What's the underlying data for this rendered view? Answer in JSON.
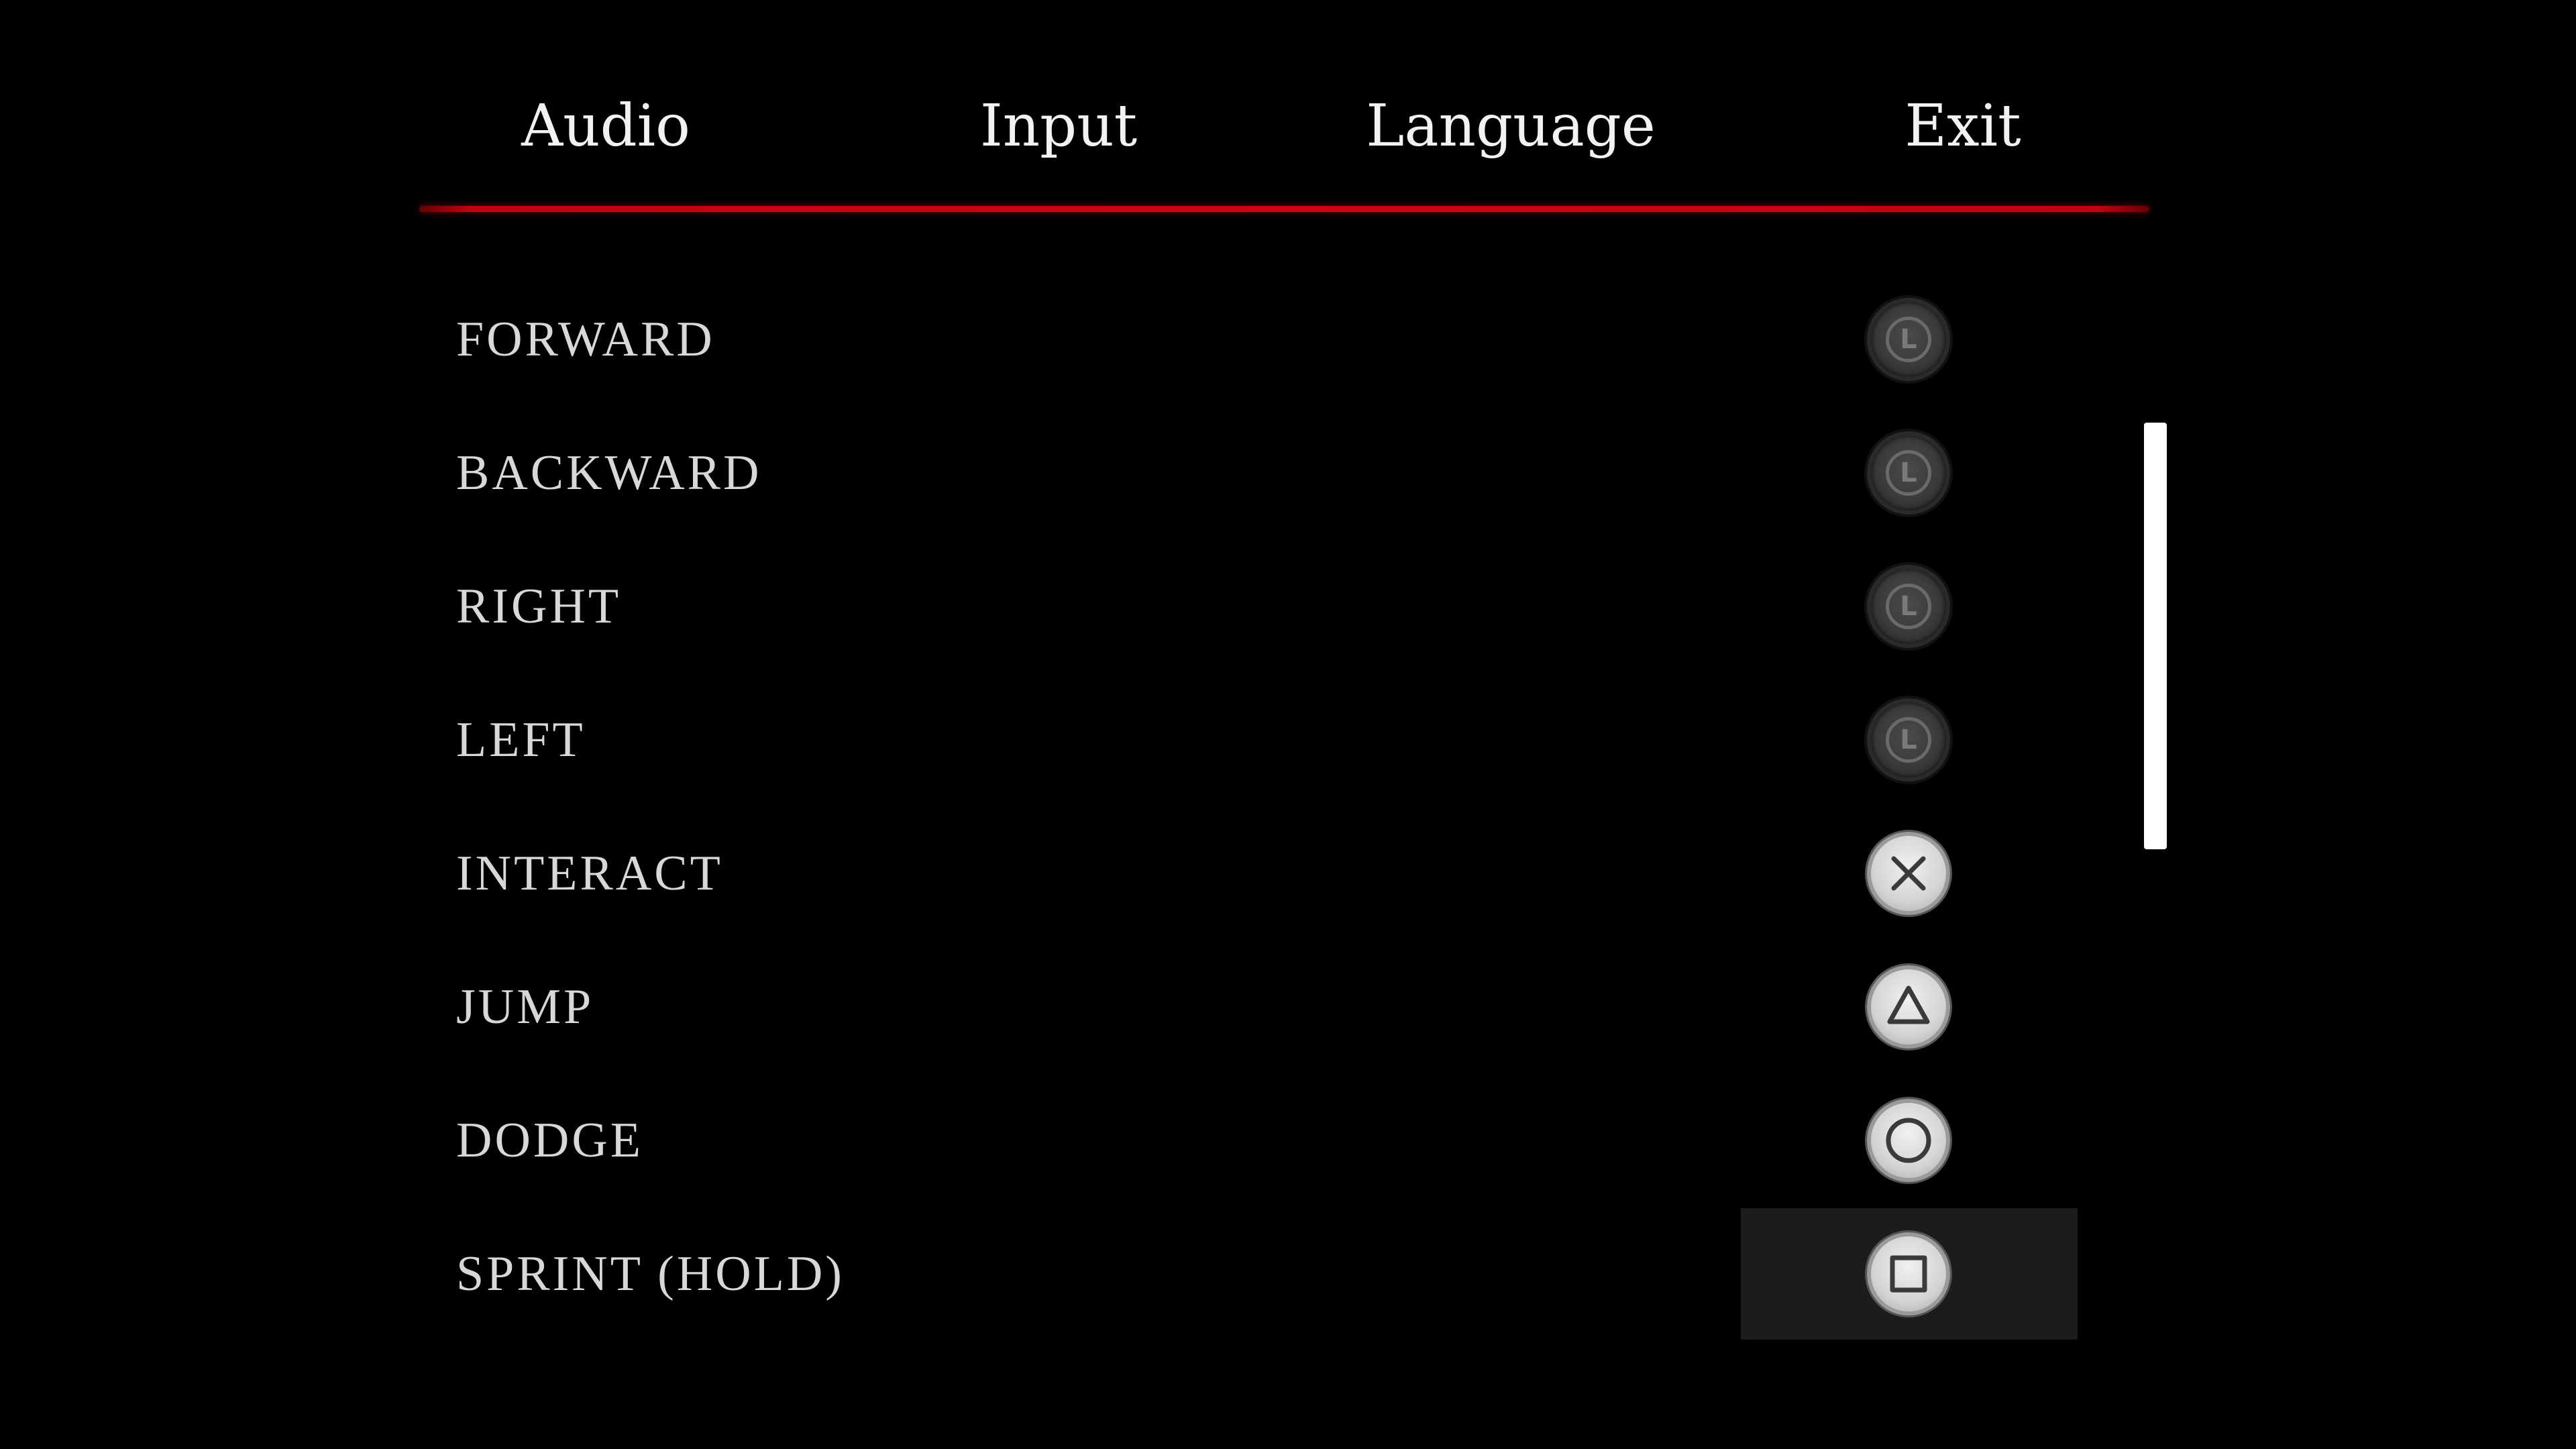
{
  "tabs": [
    {
      "label": "Audio"
    },
    {
      "label": "Input"
    },
    {
      "label": "Language"
    },
    {
      "label": "Exit"
    }
  ],
  "active_tab_index": 1,
  "colors": {
    "background": "#000000",
    "accent_line": "#d00012",
    "text": "#e8e8e8",
    "selected_row": "#1c1c1c",
    "scrollbar": "#ffffff"
  },
  "bindings": [
    {
      "action": "FORWARD",
      "button_icon": "left-stick-icon",
      "button_glyph": "L"
    },
    {
      "action": "BACKWARD",
      "button_icon": "left-stick-icon",
      "button_glyph": "L"
    },
    {
      "action": "RIGHT",
      "button_icon": "left-stick-icon",
      "button_glyph": "L"
    },
    {
      "action": "LEFT",
      "button_icon": "left-stick-icon",
      "button_glyph": "L"
    },
    {
      "action": "INTERACT",
      "button_icon": "cross-button-icon"
    },
    {
      "action": "JUMP",
      "button_icon": "triangle-button-icon"
    },
    {
      "action": "DODGE",
      "button_icon": "circle-button-icon"
    },
    {
      "action": "SPRINT (HOLD)",
      "button_icon": "square-button-icon"
    }
  ],
  "selected_binding_index": 7,
  "scroll": {
    "visible_fraction": 0.55,
    "position_fraction": 0.0
  }
}
